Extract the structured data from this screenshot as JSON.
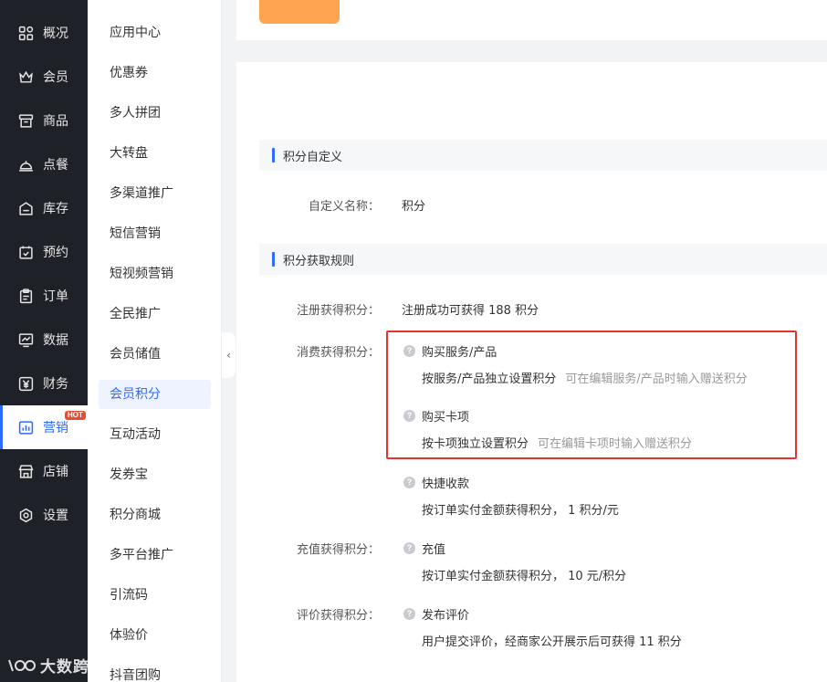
{
  "nav": {
    "items": [
      {
        "label": "概况",
        "icon": "grid-icon"
      },
      {
        "label": "会员",
        "icon": "crown-icon"
      },
      {
        "label": "商品",
        "icon": "store-box-icon"
      },
      {
        "label": "点餐",
        "icon": "cloche-icon"
      },
      {
        "label": "库存",
        "icon": "warehouse-icon"
      },
      {
        "label": "预约",
        "icon": "calendar-check-icon"
      },
      {
        "label": "订单",
        "icon": "clipboard-icon"
      },
      {
        "label": "数据",
        "icon": "chart-monitor-icon"
      },
      {
        "label": "财务",
        "icon": "yen-icon"
      },
      {
        "label": "营销",
        "icon": "marketing-icon",
        "active": true,
        "badge": "HOT"
      },
      {
        "label": "店铺",
        "icon": "shop-icon"
      },
      {
        "label": "设置",
        "icon": "settings-icon"
      }
    ]
  },
  "submenu": {
    "items": [
      "应用中心",
      "优惠券",
      "多人拼团",
      "大转盘",
      "多渠道推广",
      "短信营销",
      "短视频营销",
      "全民推广",
      "会员储值",
      "会员积分",
      "互动活动",
      "发券宝",
      "积分商城",
      "多平台推广",
      "引流码",
      "体验价",
      "抖音团购"
    ],
    "active_index": 9
  },
  "collapse_glyph": "‹",
  "sections": {
    "custom": {
      "title": "积分自定义",
      "name_label": "自定义名称：",
      "name_value": "积分"
    },
    "rules": {
      "title": "积分获取规则",
      "register_label": "注册获得积分：",
      "register_value": "注册成功可获得 188 积分",
      "consume_label": "消费获得积分：",
      "recharge_label": "充值获得积分：",
      "review_label": "评价获得积分：",
      "consume_rules": [
        {
          "title": "购买服务/产品",
          "desc": "按服务/产品独立设置积分",
          "hint": "可在编辑服务/产品时输入赠送积分"
        },
        {
          "title": "购买卡项",
          "desc": "按卡项独立设置积分",
          "hint": "可在编辑卡项时输入赠送积分"
        },
        {
          "title": "快捷收款",
          "desc": "按订单实付金额获得积分，  1 积分/元",
          "hint": ""
        }
      ],
      "recharge_rule": {
        "title": "充值",
        "desc": "按订单实付金额获得积分，  10 元/积分"
      },
      "review_rule": {
        "title": "发布评价",
        "desc": "用户提交评价，经商家公开展示后可获得 11 积分"
      }
    }
  },
  "watermark": "大数跨境",
  "colors": {
    "accent": "#2f6bff",
    "nav_bg": "#1f2128",
    "highlight": "#e0352b",
    "tile": "#ffa552",
    "badge": "#e94b35"
  }
}
